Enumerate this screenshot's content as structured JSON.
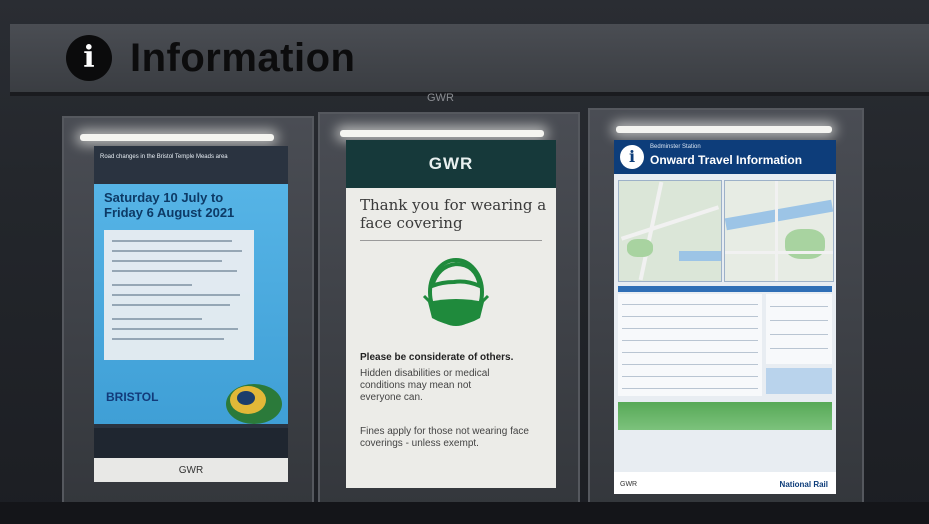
{
  "header": {
    "icon_glyph": "i",
    "title": "Information"
  },
  "center_mark": "GWR",
  "posters": {
    "left": {
      "top_text": "Road changes in the Bristol Temple Meads area",
      "date_line1": "Saturday 10 July to",
      "date_line2": "Friday 6 August 2021",
      "brand": "BRISTOL",
      "footer_logo": "GWR"
    },
    "center": {
      "logo": "GWR",
      "title": "Thank you for wearing a face covering",
      "bold_line": "Please be considerate of others.",
      "para1": "Hidden disabilities or medical conditions may mean not everyone can.",
      "para2": "Fines apply for those not wearing face coverings - unless exempt.",
      "face_icon": "face-mask-icon",
      "face_color": "#1f8a3c"
    },
    "right": {
      "info_glyph": "i",
      "station": "Bedminster Station",
      "title": "Onward Travel Information",
      "footer_left": "GWR",
      "footer_right": "National Rail"
    }
  },
  "colors": {
    "gwr_green": "#16393a",
    "info_blue": "#0d3d7a",
    "poster_blue": "#4fa9df"
  }
}
